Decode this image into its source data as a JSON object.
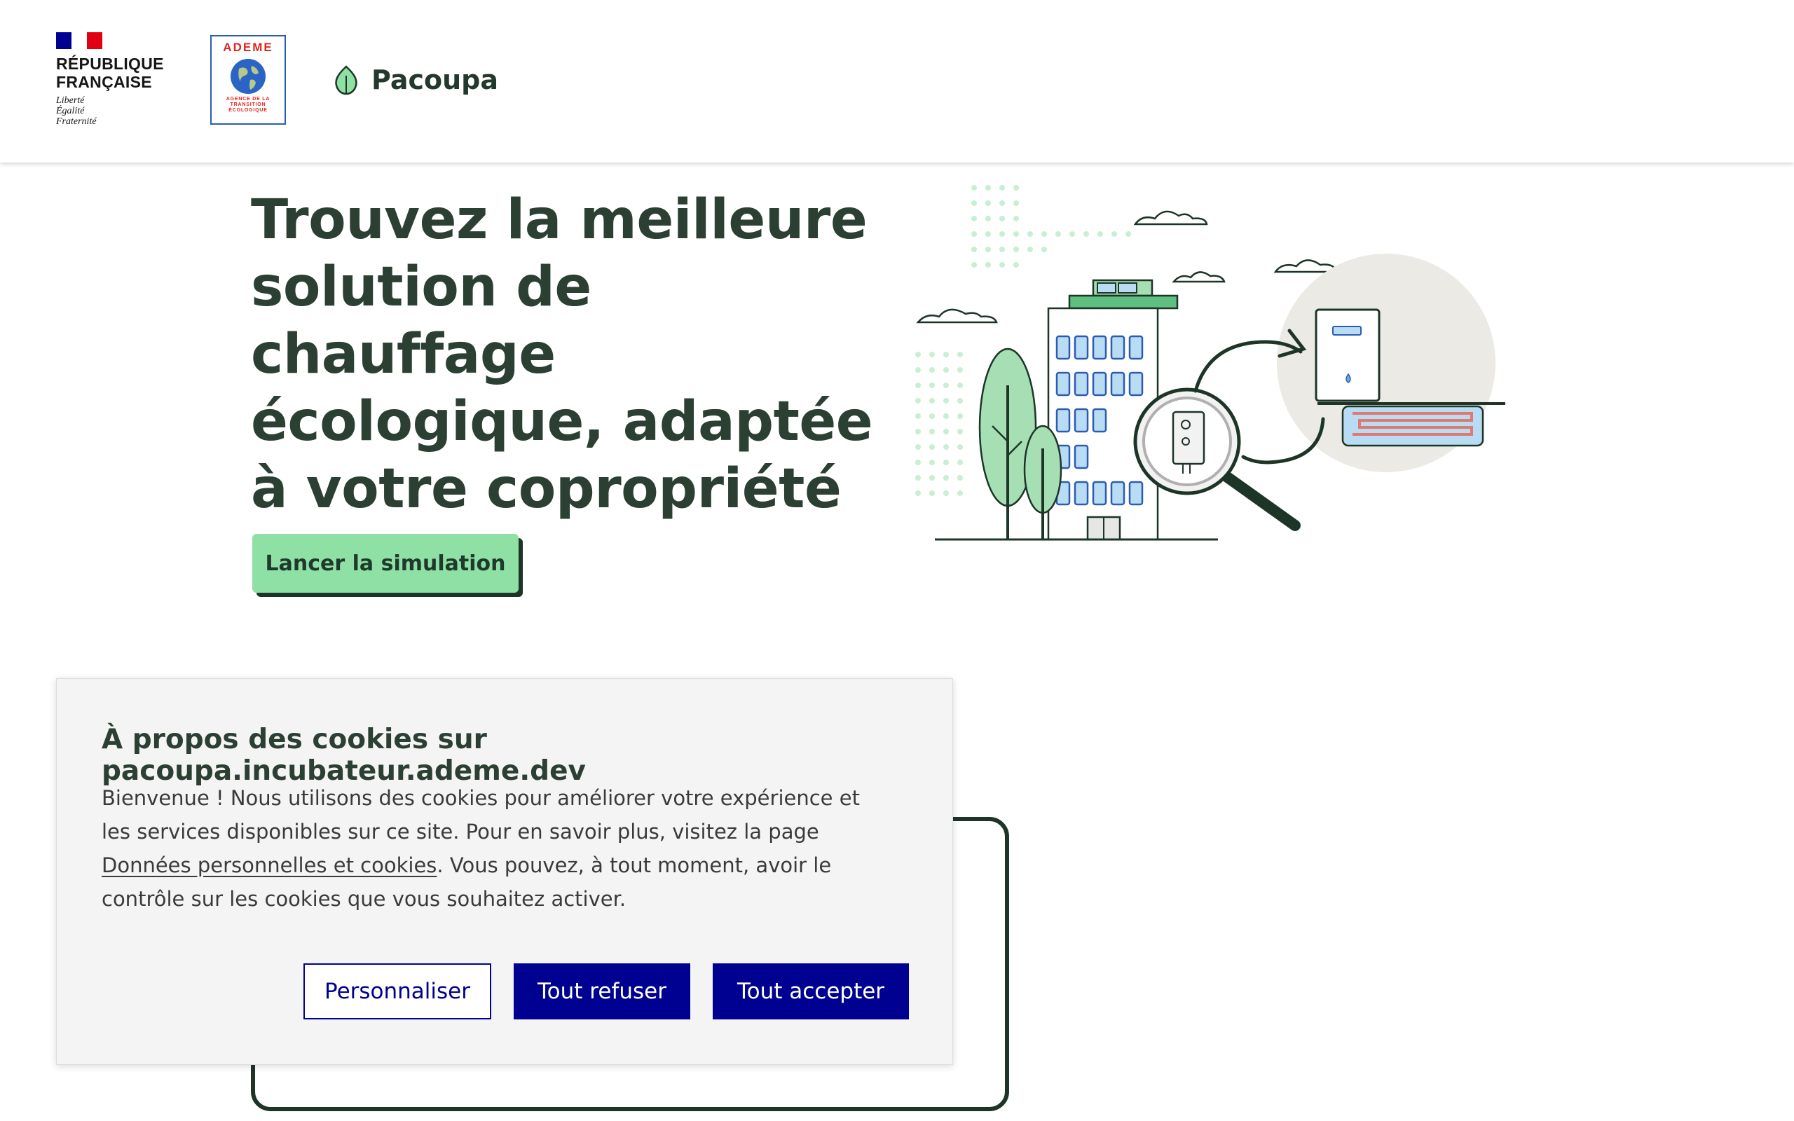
{
  "header": {
    "rf": {
      "title_line1": "RÉPUBLIQUE",
      "title_line2": "FRANÇAISE",
      "motto": [
        "Liberté",
        "Égalité",
        "Fraternité"
      ],
      "flag_colors": [
        "#000091",
        "#ffffff",
        "#e1000f"
      ]
    },
    "ademe": {
      "title": "ADEME",
      "subtitle": "AGENCE DE LA TRANSITION ÉCOLOGIQUE"
    },
    "brand": {
      "name": "Pacoupa",
      "icon": "leaf-icon"
    }
  },
  "hero": {
    "title": "Trouvez la meilleure solution de chauffage écologique, adaptée à votre copropriété",
    "cta_label": "Lancer la simulation"
  },
  "cookie": {
    "title": "À propos des cookies sur pacoupa.incubateur.ademe.dev",
    "text_before": "Bienvenue ! Nous utilisons des cookies pour améliorer votre expérience et les services disponibles sur ce site. Pour en savoir plus, visitez la page ",
    "link": "Données personnelles et cookies",
    "text_after": ".  Vous pouvez, à tout moment, avoir le contrôle sur les cookies que vous souhaitez activer.",
    "buttons": {
      "personalize": "Personnaliser",
      "refuse": "Tout refuser",
      "accept": "Tout accepter"
    }
  },
  "colors": {
    "accent": "#8ee0a5",
    "dark_green": "#1d3527",
    "dsfr_blue": "#000091"
  }
}
